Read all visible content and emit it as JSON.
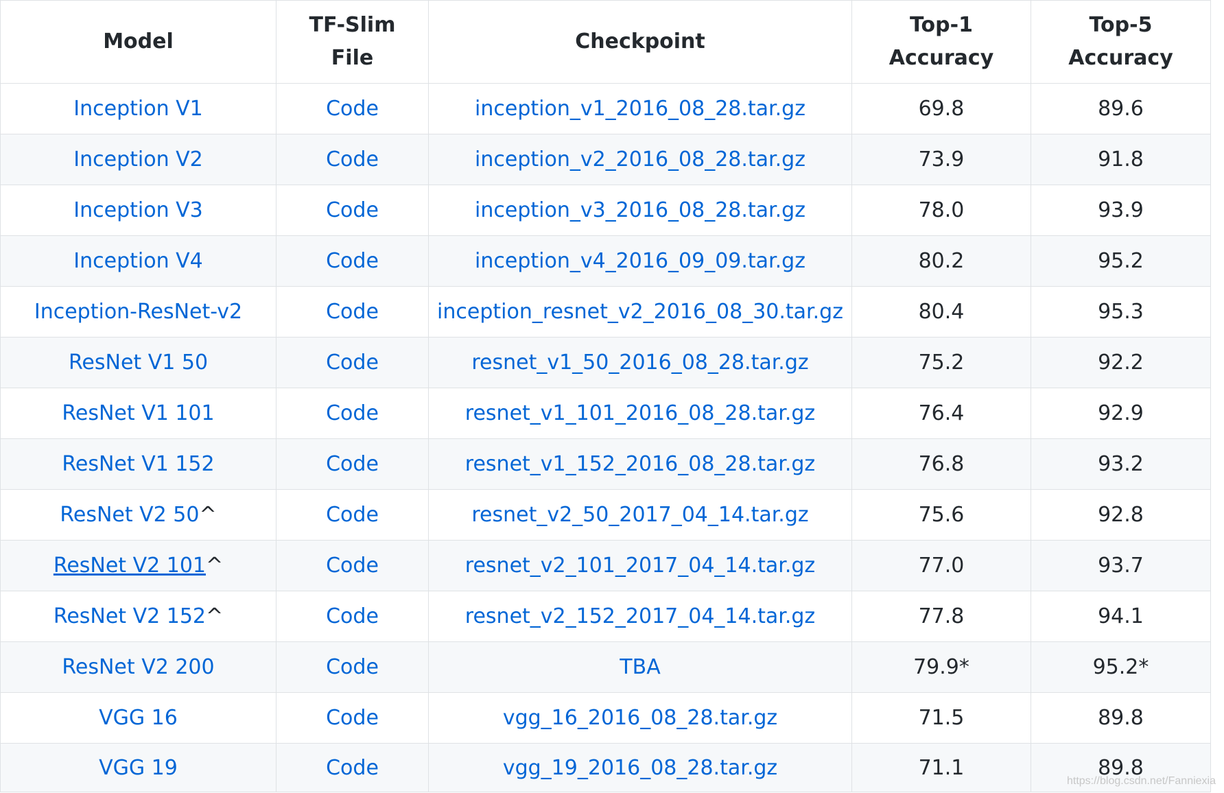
{
  "table": {
    "headers": {
      "model": "Model",
      "tfslim": [
        "TF-Slim",
        "File"
      ],
      "checkpoint": "Checkpoint",
      "top1": [
        "Top-1",
        "Accuracy"
      ],
      "top5": [
        "Top-5",
        "Accuracy"
      ]
    },
    "rows": [
      {
        "model": "Inception V1",
        "suffix": "",
        "code": "Code",
        "checkpoint": "inception_v1_2016_08_28.tar.gz",
        "top1": "69.8",
        "top5": "89.6"
      },
      {
        "model": "Inception V2",
        "suffix": "",
        "code": "Code",
        "checkpoint": "inception_v2_2016_08_28.tar.gz",
        "top1": "73.9",
        "top5": "91.8"
      },
      {
        "model": "Inception V3",
        "suffix": "",
        "code": "Code",
        "checkpoint": "inception_v3_2016_08_28.tar.gz",
        "top1": "78.0",
        "top5": "93.9"
      },
      {
        "model": "Inception V4",
        "suffix": "",
        "code": "Code",
        "checkpoint": "inception_v4_2016_09_09.tar.gz",
        "top1": "80.2",
        "top5": "95.2"
      },
      {
        "model": "Inception-ResNet-v2",
        "suffix": "",
        "code": "Code",
        "checkpoint": "inception_resnet_v2_2016_08_30.tar.gz",
        "top1": "80.4",
        "top5": "95.3"
      },
      {
        "model": "ResNet V1 50",
        "suffix": "",
        "code": "Code",
        "checkpoint": "resnet_v1_50_2016_08_28.tar.gz",
        "top1": "75.2",
        "top5": "92.2"
      },
      {
        "model": "ResNet V1 101",
        "suffix": "",
        "code": "Code",
        "checkpoint": "resnet_v1_101_2016_08_28.tar.gz",
        "top1": "76.4",
        "top5": "92.9"
      },
      {
        "model": "ResNet V1 152",
        "suffix": "",
        "code": "Code",
        "checkpoint": "resnet_v1_152_2016_08_28.tar.gz",
        "top1": "76.8",
        "top5": "93.2"
      },
      {
        "model": "ResNet V2 50",
        "suffix": "^",
        "code": "Code",
        "checkpoint": "resnet_v2_50_2017_04_14.tar.gz",
        "top1": "75.6",
        "top5": "92.8"
      },
      {
        "model": "ResNet V2 101",
        "suffix": "^",
        "code": "Code",
        "checkpoint": "resnet_v2_101_2017_04_14.tar.gz",
        "top1": "77.0",
        "top5": "93.7"
      },
      {
        "model": "ResNet V2 152",
        "suffix": "^",
        "code": "Code",
        "checkpoint": "resnet_v2_152_2017_04_14.tar.gz",
        "top1": "77.8",
        "top5": "94.1"
      },
      {
        "model": "ResNet V2 200",
        "suffix": "",
        "code": "Code",
        "checkpoint": "TBA",
        "top1": "79.9*",
        "top5": "95.2*"
      },
      {
        "model": "VGG 16",
        "suffix": "",
        "code": "Code",
        "checkpoint": "vgg_16_2016_08_28.tar.gz",
        "top1": "71.5",
        "top5": "89.8"
      },
      {
        "model": "VGG 19",
        "suffix": "",
        "code": "Code",
        "checkpoint": "vgg_19_2016_08_28.tar.gz",
        "top1": "71.1",
        "top5": "89.8"
      }
    ]
  },
  "watermark": "https://blog.csdn.net/Fanniexia",
  "colors": {
    "link": "#0366d6",
    "text": "#24292e",
    "border": "#dfe2e5",
    "stripe": "#f6f8fa"
  }
}
